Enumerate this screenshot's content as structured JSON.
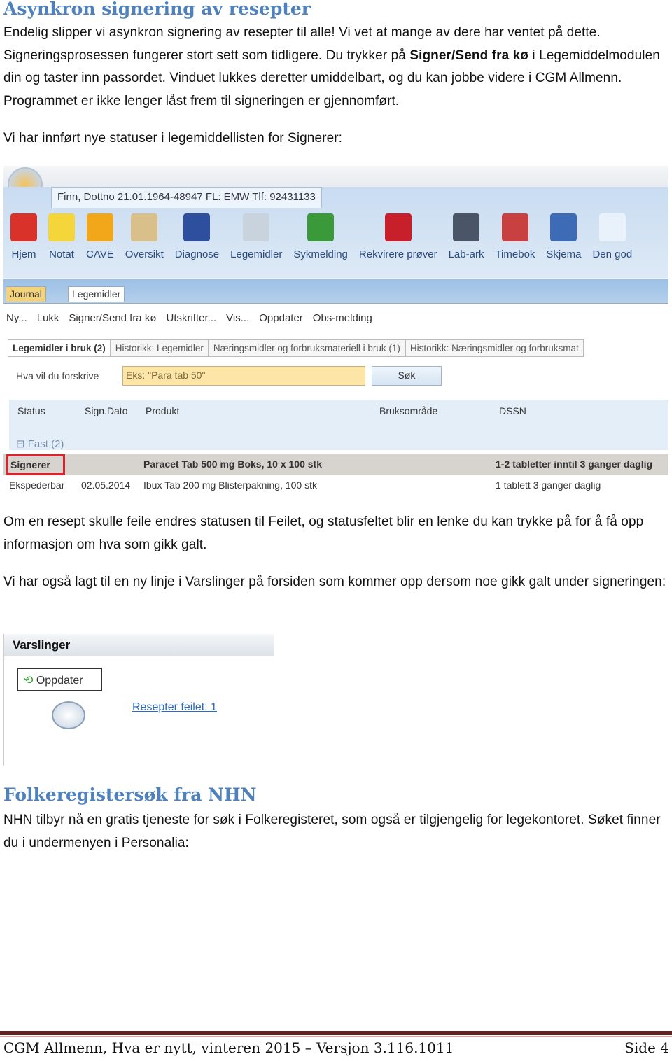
{
  "section1": {
    "title": "Asynkron signering av resepter",
    "para1_parts": [
      "Endelig slipper vi asynkron signering av resepter til alle! Vi vet at mange av dere har ventet på dette. Signeringsprosessen fungerer stort sett som tidligere. Du trykker på ",
      "Signer/Send fra kø",
      " i Legemiddelmodulen din og taster inn passordet. Vinduet lukkes deretter umiddelbart, og du kan jobbe videre i CGM Allmenn. Programmet er ikke lenger låst frem til signeringen er gjennomført."
    ],
    "para2": "Vi har innført nye statuser i legemiddellisten for Signerer:",
    "para3": "Om en resept skulle feile endres statusen til Feilet, og statusfeltet blir en lenke du kan trykke på for å få opp informasjon om hva som gikk galt.",
    "para4": "Vi har også lagt til en ny linje i Varslinger på forsiden som kommer opp dersom noe gikk galt under signeringen:"
  },
  "app": {
    "patient_tab": "Finn, Dottno 21.01.1964-48947 FL: EMW Tlf: 92431133",
    "ribbon": [
      {
        "label": "Hjem",
        "icon": "home-icon",
        "color": "#d9322b"
      },
      {
        "label": "Notat",
        "icon": "note-icon",
        "color": "#f5d63a"
      },
      {
        "label": "CAVE",
        "icon": "warning-icon",
        "color": "#f2a71b"
      },
      {
        "label": "Oversikt",
        "icon": "folder-icon",
        "color": "#d9c08a"
      },
      {
        "label": "Diagnose",
        "icon": "stethoscope-icon",
        "color": "#2e4f9e"
      },
      {
        "label": "Legemidler",
        "icon": "pill-icon",
        "color": "#c8d3de"
      },
      {
        "label": "Sykmelding",
        "icon": "wheelchair-icon",
        "color": "#3a9a3a"
      },
      {
        "label": "Rekvirere prøver",
        "icon": "test-tube-icon",
        "color": "#c8202a"
      },
      {
        "label": "Lab-ark",
        "icon": "lab-sheet-icon",
        "color": "#4a5568"
      },
      {
        "label": "Timebok",
        "icon": "calendar-icon",
        "color": "#c84040"
      },
      {
        "label": "Skjema",
        "icon": "form-icon",
        "color": "#3d6bb5"
      },
      {
        "label": "Den god",
        "icon": "",
        "color": "#e9f1fa"
      }
    ],
    "module_tabs": [
      "Journal",
      "Legemidler"
    ],
    "toolbar": [
      "Ny...",
      "Lukk",
      "Signer/Send fra kø",
      "Utskrifter...",
      "Vis...",
      "Oppdater",
      "Obs-melding"
    ],
    "subtabs": [
      "Legemidler i bruk (2)",
      "Historikk: Legemidler",
      "Næringsmidler og forbruksmateriell i bruk (1)",
      "Historikk: Næringsmidler og forbruksmat"
    ],
    "search_label": "Hva vil du forskrive",
    "search_placeholder": "Eks: \"Para tab 50\"",
    "search_button": "Søk",
    "columns": [
      "Status",
      "Sign.Dato",
      "Produkt",
      "Bruksområde",
      "DSSN"
    ],
    "group": "Fast (2)",
    "rows": [
      {
        "status": "Signerer",
        "date": "",
        "product": "Paracet Tab 500 mg Boks, 10 x 100 stk",
        "dssn": "1-2 tabletter inntil 3 ganger daglig"
      },
      {
        "status": "Ekspederbar",
        "date": "02.05.2014",
        "product": "Ibux Tab 200 mg Blisterpakning, 100 stk",
        "dssn": "1 tablett 3 ganger daglig"
      }
    ]
  },
  "varsl": {
    "title": "Varslinger",
    "refresh": "Oppdater",
    "link": "Resepter feilet: 1"
  },
  "section2": {
    "title": "Folkeregistersøk fra NHN",
    "para": "NHN tilbyr nå en gratis tjeneste for søk i Folkeregisteret, som også er tilgjengelig for legekontoret. Søket finner du i undermenyen i Personalia:"
  },
  "footer": {
    "text": "CGM Allmenn, Hva er nytt, vinteren 2015 – Versjon 3.116.1011",
    "page": "Side 4"
  }
}
